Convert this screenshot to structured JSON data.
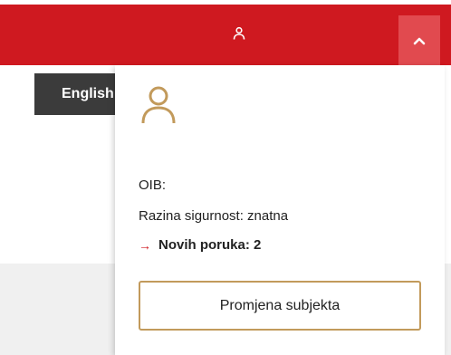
{
  "header": {
    "user_icon": "user-icon",
    "collapse_icon": "chevron-up-icon",
    "background_color": "#cf1920",
    "collapse_button_color": "#e14a4f"
  },
  "language_button": {
    "label": "English"
  },
  "user_panel": {
    "avatar_icon": "user-icon",
    "avatar_color": "#c29a5b",
    "oib_label": "OIB:",
    "security_level": "Razina sigurnost: znatna",
    "messages_label": "Novih poruka: 2",
    "messages_arrow": "→",
    "change_subject_button": "Promjena subjekta"
  }
}
